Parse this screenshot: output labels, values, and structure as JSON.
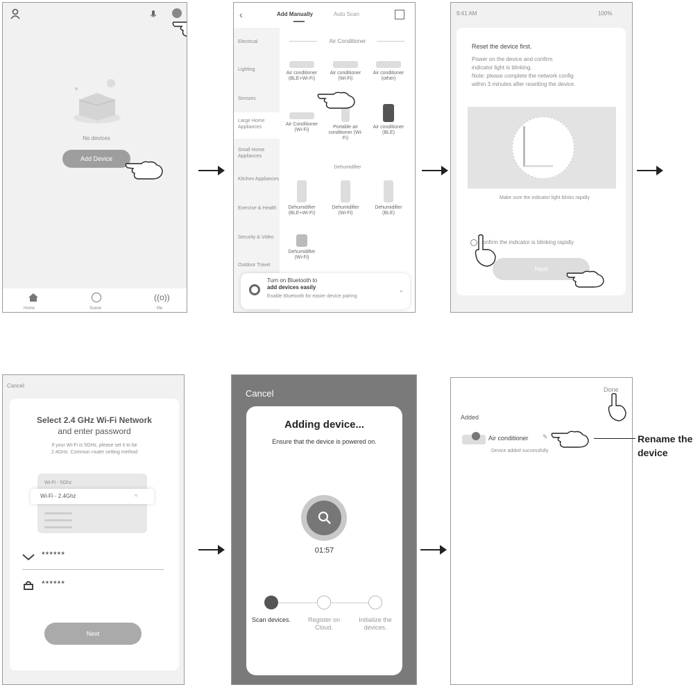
{
  "panel1": {
    "empty_label": "No devices",
    "add_button": "Add Device",
    "nav": [
      "Home",
      "Scene",
      "Me"
    ]
  },
  "panel2": {
    "tabs": [
      "Add Manually",
      "Auto Scan"
    ],
    "section_title": "Air Conditioner",
    "sidebar": [
      "Electrical",
      "Lighting",
      "Sensors",
      "Large Home Appliances",
      "Small Home Appliances",
      "Kitchen Appliances",
      "Exercise & Health",
      "Security & Video",
      "Outdoor Travel"
    ],
    "products_row1": [
      "Air conditioner (BLE+Wi-Fi)",
      "Air conditioner (Wi-Fi)",
      "Air conditioner (other)"
    ],
    "products_row2": [
      "Air Conditioner (Wi-Fi)",
      "Portable air conditioner (Wi-Fi)",
      "Air conditioner (BLE)"
    ],
    "section2_title": "Dehumidifier",
    "products_row3": [
      "Dehumidifier (BLE+Wi-Fi)",
      "Dehumidifier (Wi-Fi)",
      "Dehumidifier (BLE)"
    ],
    "products_row4": [
      "Dehumidifier (Wi-Fi)"
    ],
    "banner_title": "Turn on Bluetooth to",
    "banner_title2": "add devices easily",
    "banner_sub": "Enable Bluetooth for easier device pairing"
  },
  "panel3": {
    "status_left": "9:41 AM",
    "status_right": "100%",
    "title": "Reset the device first.",
    "body1": "Power on the device and confirm",
    "body2": "indicator light is blinking.",
    "body3": "Note: please complete the network config",
    "body4": "within 3 minutes after resetting the device.",
    "caption": "Make sure the indicator light blinks rapidly",
    "confirm": "Confirm the indicator is blinking rapidly",
    "next_button": "Next"
  },
  "panel4": {
    "cancel": "Cancel",
    "title_line1": "Select 2.4 GHz Wi-Fi Network",
    "title_line2": "and enter password",
    "subtitle1": "If your Wi-Fi is 5GHz, please set it to be",
    "subtitle2": "2.4GHz. Common router setting method",
    "wifi_5g": "Wi-Fi - 5Ghz",
    "wifi_24g": "Wi-Fi - 2.4Ghz",
    "wifi_field": "******",
    "password_field": "******",
    "next_button": "Next"
  },
  "panel5": {
    "cancel": "Cancel",
    "title": "Adding device...",
    "subtitle": "Ensure that the device is powered on.",
    "timer": "01:57",
    "steps": [
      "Scan devices.",
      "Register on Cloud.",
      "Initialize the devices."
    ]
  },
  "panel6": {
    "done": "Done",
    "added": "Added",
    "device_name": "Air conditioner",
    "device_status": "Device added successfully",
    "annotation_line1": "Rename the",
    "annotation_line2": "device"
  },
  "colors": {
    "panel_bg": "#f1f1f1",
    "dark_overlay": "#7a7a7a",
    "button_gray": "#aaaaaa",
    "accent": "#4d4d4d"
  }
}
